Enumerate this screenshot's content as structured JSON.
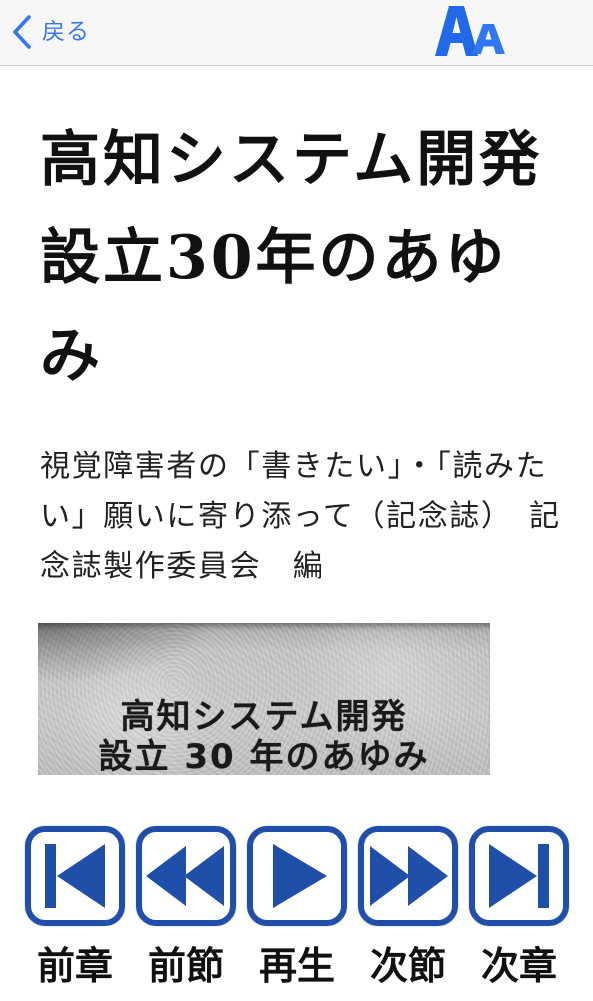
{
  "nav": {
    "back_label": "戻る",
    "back_icon": "chevron-left-icon",
    "font_size_icon": "text-size-icon"
  },
  "book": {
    "title": "高知システム開発設立30年のあゆみ",
    "subtitle": "視覚障害者の「書きたい」・「読みたい」願いに寄り添って（記念誌）　記念誌製作委員会　編",
    "cover_image": {
      "line1": "高知システム開発",
      "line2": "設立 30 年のあゆみ"
    }
  },
  "controls": [
    {
      "label": "前章",
      "icon": "previous-chapter-icon"
    },
    {
      "label": "前節",
      "icon": "previous-section-icon"
    },
    {
      "label": "再生",
      "icon": "play-icon"
    },
    {
      "label": "次節",
      "icon": "next-section-icon"
    },
    {
      "label": "次章",
      "icon": "next-chapter-icon"
    }
  ],
  "colors": {
    "accent": "#3478f6",
    "control_blue": "#1f4fa8",
    "nav_background": "#f7f7f7"
  }
}
